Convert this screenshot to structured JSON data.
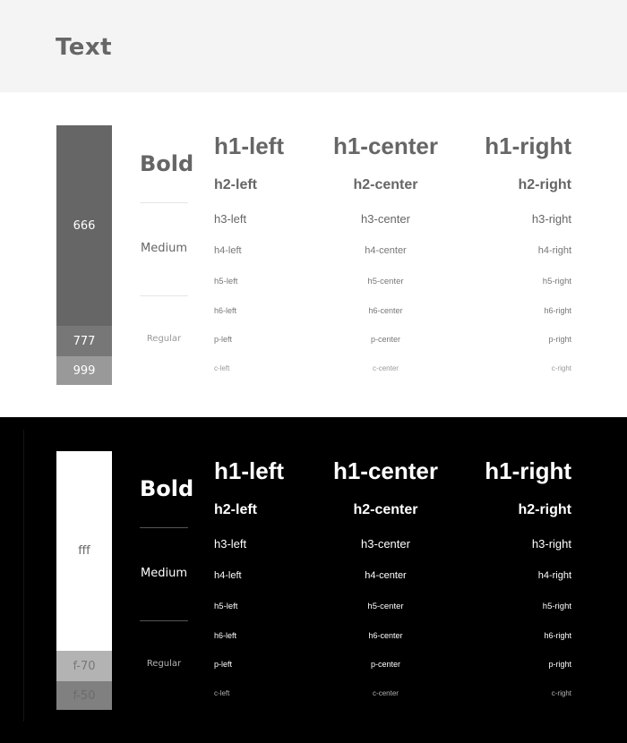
{
  "header": {
    "title": "Text"
  },
  "light": {
    "swatches": [
      {
        "label": "666",
        "color": "#666666",
        "text_color": "#ffffff"
      },
      {
        "label": "777",
        "color": "#777777",
        "text_color": "#ffffff"
      },
      {
        "label": "999",
        "color": "#999999",
        "text_color": "#ffffff"
      }
    ],
    "weights": {
      "bold": "Bold",
      "medium": "Medium",
      "regular": "Regular"
    },
    "colors": {
      "heading": "#666666",
      "h3": "#666666",
      "body": "#777777",
      "caption": "#999999",
      "divider": "#e6e6e6"
    }
  },
  "dark": {
    "swatches": [
      {
        "label": "fff",
        "color": "#ffffff",
        "text_color": "#666666"
      },
      {
        "label": "f-70",
        "color": "#b3b3b3",
        "text_color": "#777777"
      },
      {
        "label": "f-50",
        "color": "#808080",
        "text_color": "#6b6b6b"
      }
    ],
    "weights": {
      "bold": "Bold",
      "medium": "Medium",
      "regular": "Regular"
    },
    "colors": {
      "heading": "#ffffff",
      "h3": "#ffffff",
      "body": "#ffffff",
      "caption": "#b3b3b3",
      "divider": "#555555"
    }
  },
  "rows": {
    "h1": {
      "left": "h1-left",
      "center": "h1-center",
      "right": "h1-right"
    },
    "h2": {
      "left": "h2-left",
      "center": "h2-center",
      "right": "h2-right"
    },
    "h3": {
      "left": "h3-left",
      "center": "h3-center",
      "right": "h3-right"
    },
    "h4": {
      "left": "h4-left",
      "center": "h4-center",
      "right": "h4-right"
    },
    "h5": {
      "left": "h5-left",
      "center": "h5-center",
      "right": "h5-right"
    },
    "h6": {
      "left": "h6-left",
      "center": "h6-center",
      "right": "h6-right"
    },
    "p": {
      "left": "p-left",
      "center": "p-center",
      "right": "p-right"
    },
    "c": {
      "left": "c-left",
      "center": "c-center",
      "right": "c-right"
    }
  }
}
